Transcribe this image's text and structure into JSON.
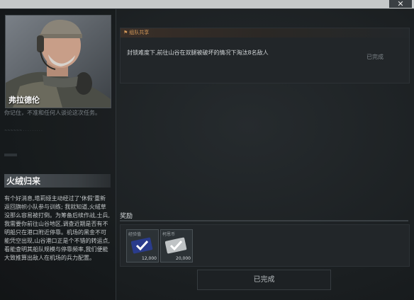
{
  "window": {
    "close_label": "✕"
  },
  "character": {
    "name": "弗拉德伦",
    "quote": "你记住，不准和任何人谈论这次任务。",
    "faded_text": "~~~~~~\n· · · · · · · · ·"
  },
  "mission": {
    "title": "火绒归来",
    "description": "有个好消息,塔莉娅主动经过了'休假'重新返回旗帜小队参与训练; 我就知道,火绒草没那么容易被打倒。为筹备后续作战,士兵,我需要你前往山谷地区,调查近期是否有不明船只在港口附近停靠。机场的黑金不可能凭空出现,山谷港口正是个不错的转运点,看能查明其船队规模与停靠频率,我们便能大致推算出敌人在机场的兵力配置。"
  },
  "task": {
    "tag": "组队共享",
    "tag_icon": "flag-icon",
    "text": "封锁难度下,前往山谷在双腿被破坏的情况下淘汰8名敌人",
    "status": "已完成"
  },
  "rewards": {
    "label": "奖励",
    "items": [
      {
        "name": "经验值",
        "amount": "12,000",
        "icon": "exp-card-icon",
        "accent": "#2a3c8c"
      },
      {
        "name": "柯恩币",
        "amount": "20,000",
        "icon": "coin-card-icon",
        "accent": "#bfc3c5"
      }
    ]
  },
  "status_button": {
    "label": "已完成"
  },
  "colors": {
    "accent_orange": "#d69a5a",
    "panel": "#222629",
    "background": "#1b1f22"
  }
}
